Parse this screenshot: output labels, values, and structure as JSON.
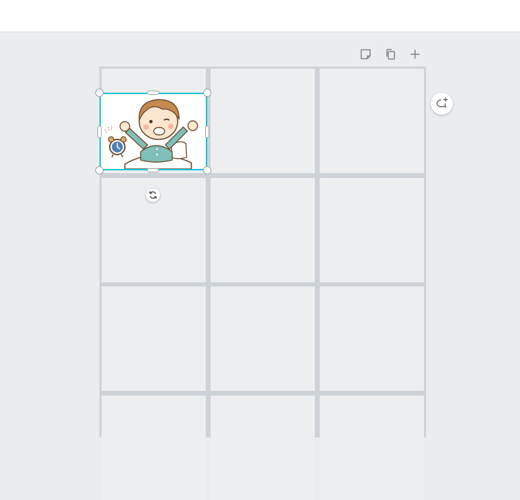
{
  "app": {
    "accent_color": "#13c4d6",
    "background_color": "#ebecee",
    "cell_color": "#eceef0",
    "gutter_color": "#cdd2d7"
  },
  "page_actions": [
    {
      "name": "notes-icon"
    },
    {
      "name": "duplicate-page-icon"
    },
    {
      "name": "add-page-icon"
    }
  ],
  "comment_button": {
    "icon": "comment-add-icon"
  },
  "grid": {
    "rows": 4,
    "columns": 3
  },
  "selected_element": {
    "type": "image",
    "description_icon": "waking-boy-illustration",
    "rotate_icon": "rotate-icon"
  }
}
